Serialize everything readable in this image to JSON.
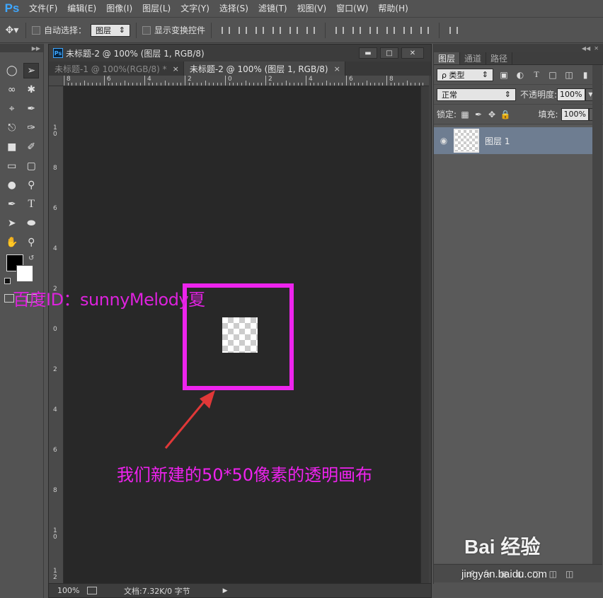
{
  "app": {
    "logo": "Ps"
  },
  "menu": [
    "文件(F)",
    "编辑(E)",
    "图像(I)",
    "图层(L)",
    "文字(Y)",
    "选择(S)",
    "滤镜(T)",
    "视图(V)",
    "窗口(W)",
    "帮助(H)"
  ],
  "options": {
    "auto_select_label": "自动选择：",
    "auto_select_value": "图层",
    "show_transform_label": "显示变换控件"
  },
  "document": {
    "window_title": "未标题-2 @ 100% (图层 1, RGB/8)",
    "tabs": [
      {
        "label": "未标题-1 @ 100%(RGB/8) *",
        "close": "×"
      },
      {
        "label": "未标题-2 @ 100% (图层 1, RGB/8)",
        "close": "×"
      }
    ],
    "hruler_labels": [
      "8",
      "6",
      "4",
      "2",
      "0",
      "2",
      "4",
      "6",
      "8"
    ],
    "vruler_labels": [
      "1\n0",
      "8",
      "6",
      "4",
      "2",
      "0",
      "2",
      "4",
      "6",
      "8",
      "1\n0",
      "1\n2"
    ],
    "status": {
      "zoom": "100%",
      "doc_info": "文档:7.32K/0 字节"
    }
  },
  "annotations": {
    "watermark": "百度ID：sunnyMelody夏",
    "caption": "我们新建的50*50像素的透明画布",
    "highlight_color": "#ee24ee"
  },
  "panel": {
    "tabs": [
      "图层",
      "通道",
      "路径"
    ],
    "filter_kind": "ρ 类型",
    "blend_mode": "正常",
    "opacity_label": "不透明度:",
    "opacity_value": "100%",
    "lock_label": "锁定:",
    "fill_label": "填充:",
    "fill_value": "100%",
    "layer_name": "图层 1"
  },
  "baidu": {
    "logo": "Bai 经验",
    "url": "jingyan.baidu.com"
  }
}
